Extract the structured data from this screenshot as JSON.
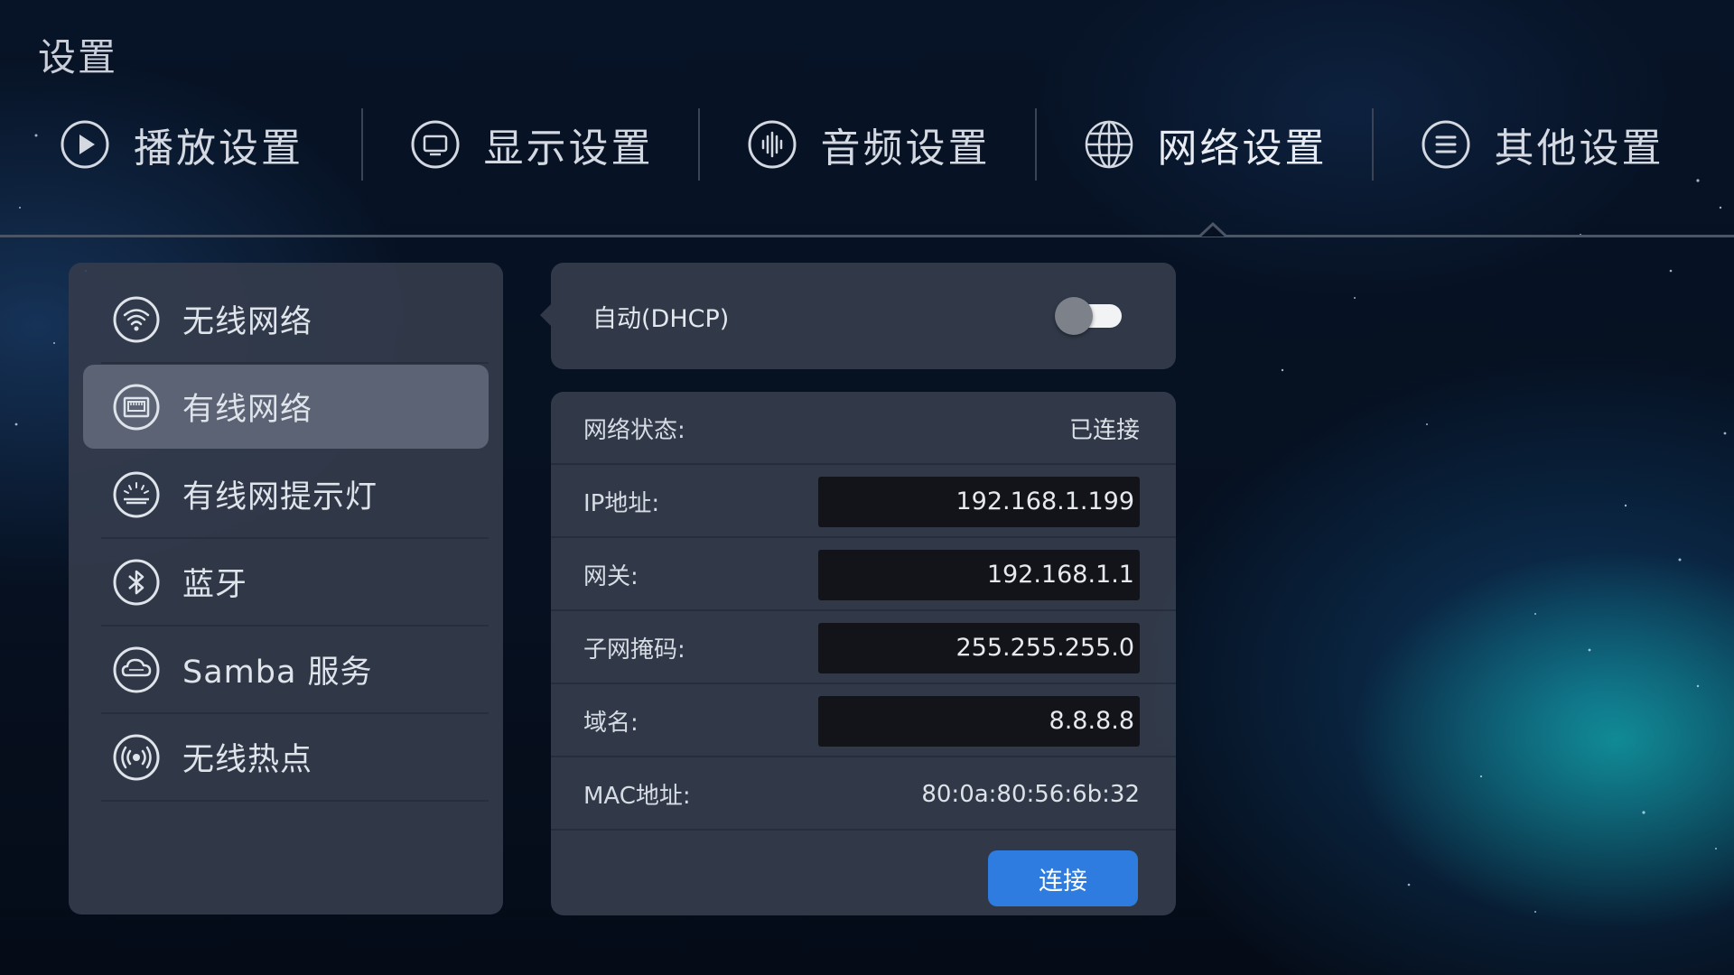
{
  "app_title": "设置",
  "tabs": [
    {
      "label": "播放设置",
      "icon": "play-icon"
    },
    {
      "label": "显示设置",
      "icon": "monitor-icon"
    },
    {
      "label": "音频设置",
      "icon": "audio-waveform-icon"
    },
    {
      "label": "网络设置",
      "icon": "globe-icon",
      "active": true
    },
    {
      "label": "其他设置",
      "icon": "menu-icon"
    }
  ],
  "sidebar": {
    "items": [
      {
        "label": "无线网络",
        "icon": "wifi-icon"
      },
      {
        "label": "有线网络",
        "icon": "ethernet-icon",
        "active": true
      },
      {
        "label": "有线网提示灯",
        "icon": "indicator-light-icon"
      },
      {
        "label": "蓝牙",
        "icon": "bluetooth-icon"
      },
      {
        "label": "Samba 服务",
        "icon": "samba-icon"
      },
      {
        "label": "无线热点",
        "icon": "hotspot-icon"
      }
    ]
  },
  "dhcp": {
    "label": "自动(DHCP)",
    "enabled": false
  },
  "network_info": {
    "status_label": "网络状态:",
    "status_value": "已连接",
    "ip_label": "IP地址:",
    "ip_value": "192.168.1.199",
    "gateway_label": "网关:",
    "gateway_value": "192.168.1.1",
    "subnet_label": "子网掩码:",
    "subnet_value": "255.255.255.0",
    "dns_label": "域名:",
    "dns_value": "8.8.8.8",
    "mac_label": "MAC地址:",
    "mac_value": "80:0a:80:56:6b:32",
    "connect_label": "连接"
  },
  "colors": {
    "accent_button": "#2f7ce0",
    "panel": "#343c4c",
    "active_item": "#5b6374",
    "background": "#061020"
  }
}
